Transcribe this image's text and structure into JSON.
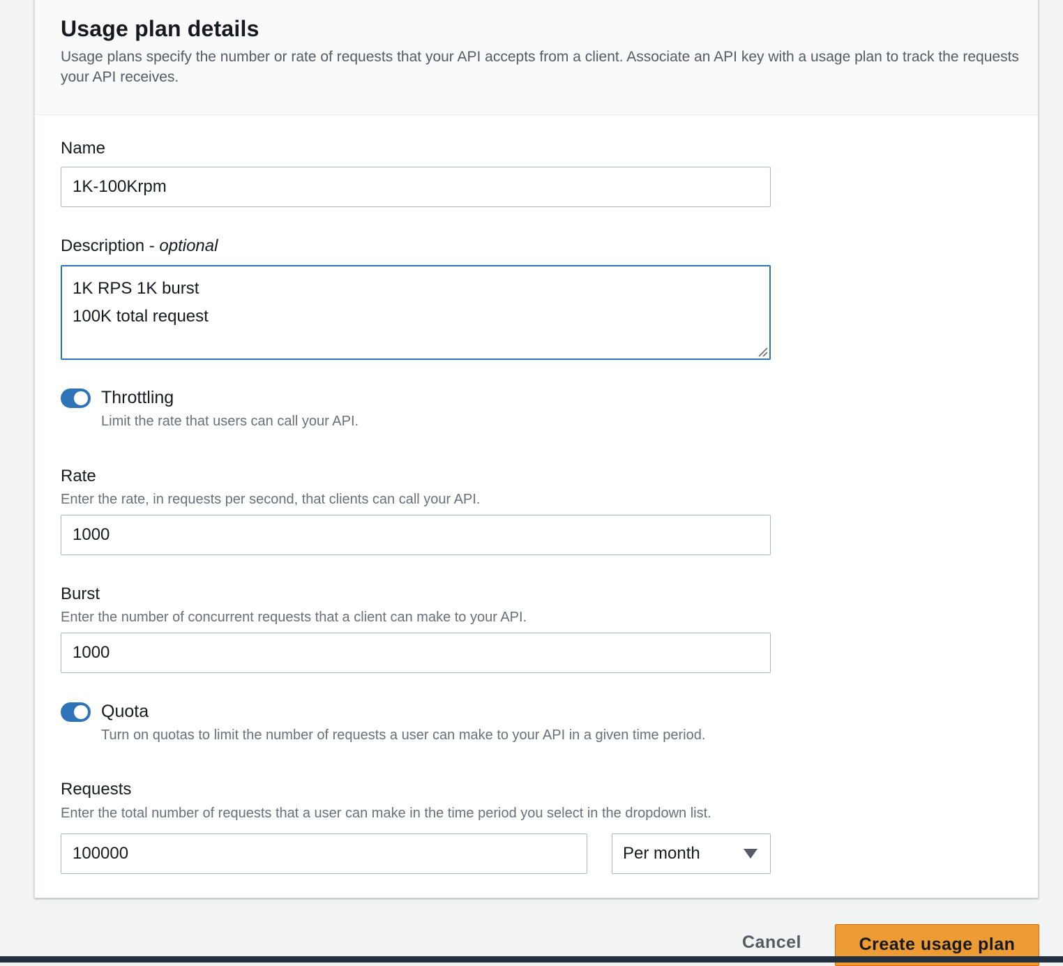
{
  "header": {
    "title": "Usage plan details",
    "description": "Usage plans specify the number or rate of requests that your API accepts from a client. Associate an API key with a usage plan to track the requests your API receives."
  },
  "name_field": {
    "label": "Name",
    "value": "1K-100Krpm"
  },
  "description_field": {
    "label": "Description - ",
    "label_optional": "optional",
    "lines": [
      "1K RPS 1K burst",
      "100K total request"
    ]
  },
  "throttling": {
    "label": "Throttling",
    "hint": "Limit the rate that users can call your API.",
    "enabled": true
  },
  "rate_field": {
    "label": "Rate",
    "hint": "Enter the rate, in requests per second, that clients can call your API.",
    "value": "1000"
  },
  "burst_field": {
    "label": "Burst",
    "hint": "Enter the number of concurrent requests that a client can make to your API.",
    "value": "1000"
  },
  "quota": {
    "label": "Quota",
    "hint": "Turn on quotas to limit the number of requests a user can make to your API in a given time period.",
    "enabled": true
  },
  "requests_field": {
    "label": "Requests",
    "hint": "Enter the total number of requests that a user can make in the time period you select in the dropdown list.",
    "value": "100000",
    "period": "Per month"
  },
  "actions": {
    "cancel_label": "Cancel",
    "create_label": "Create usage plan"
  },
  "colors": {
    "accent": "#2e73b8",
    "primary_button": "#ec9b35"
  }
}
